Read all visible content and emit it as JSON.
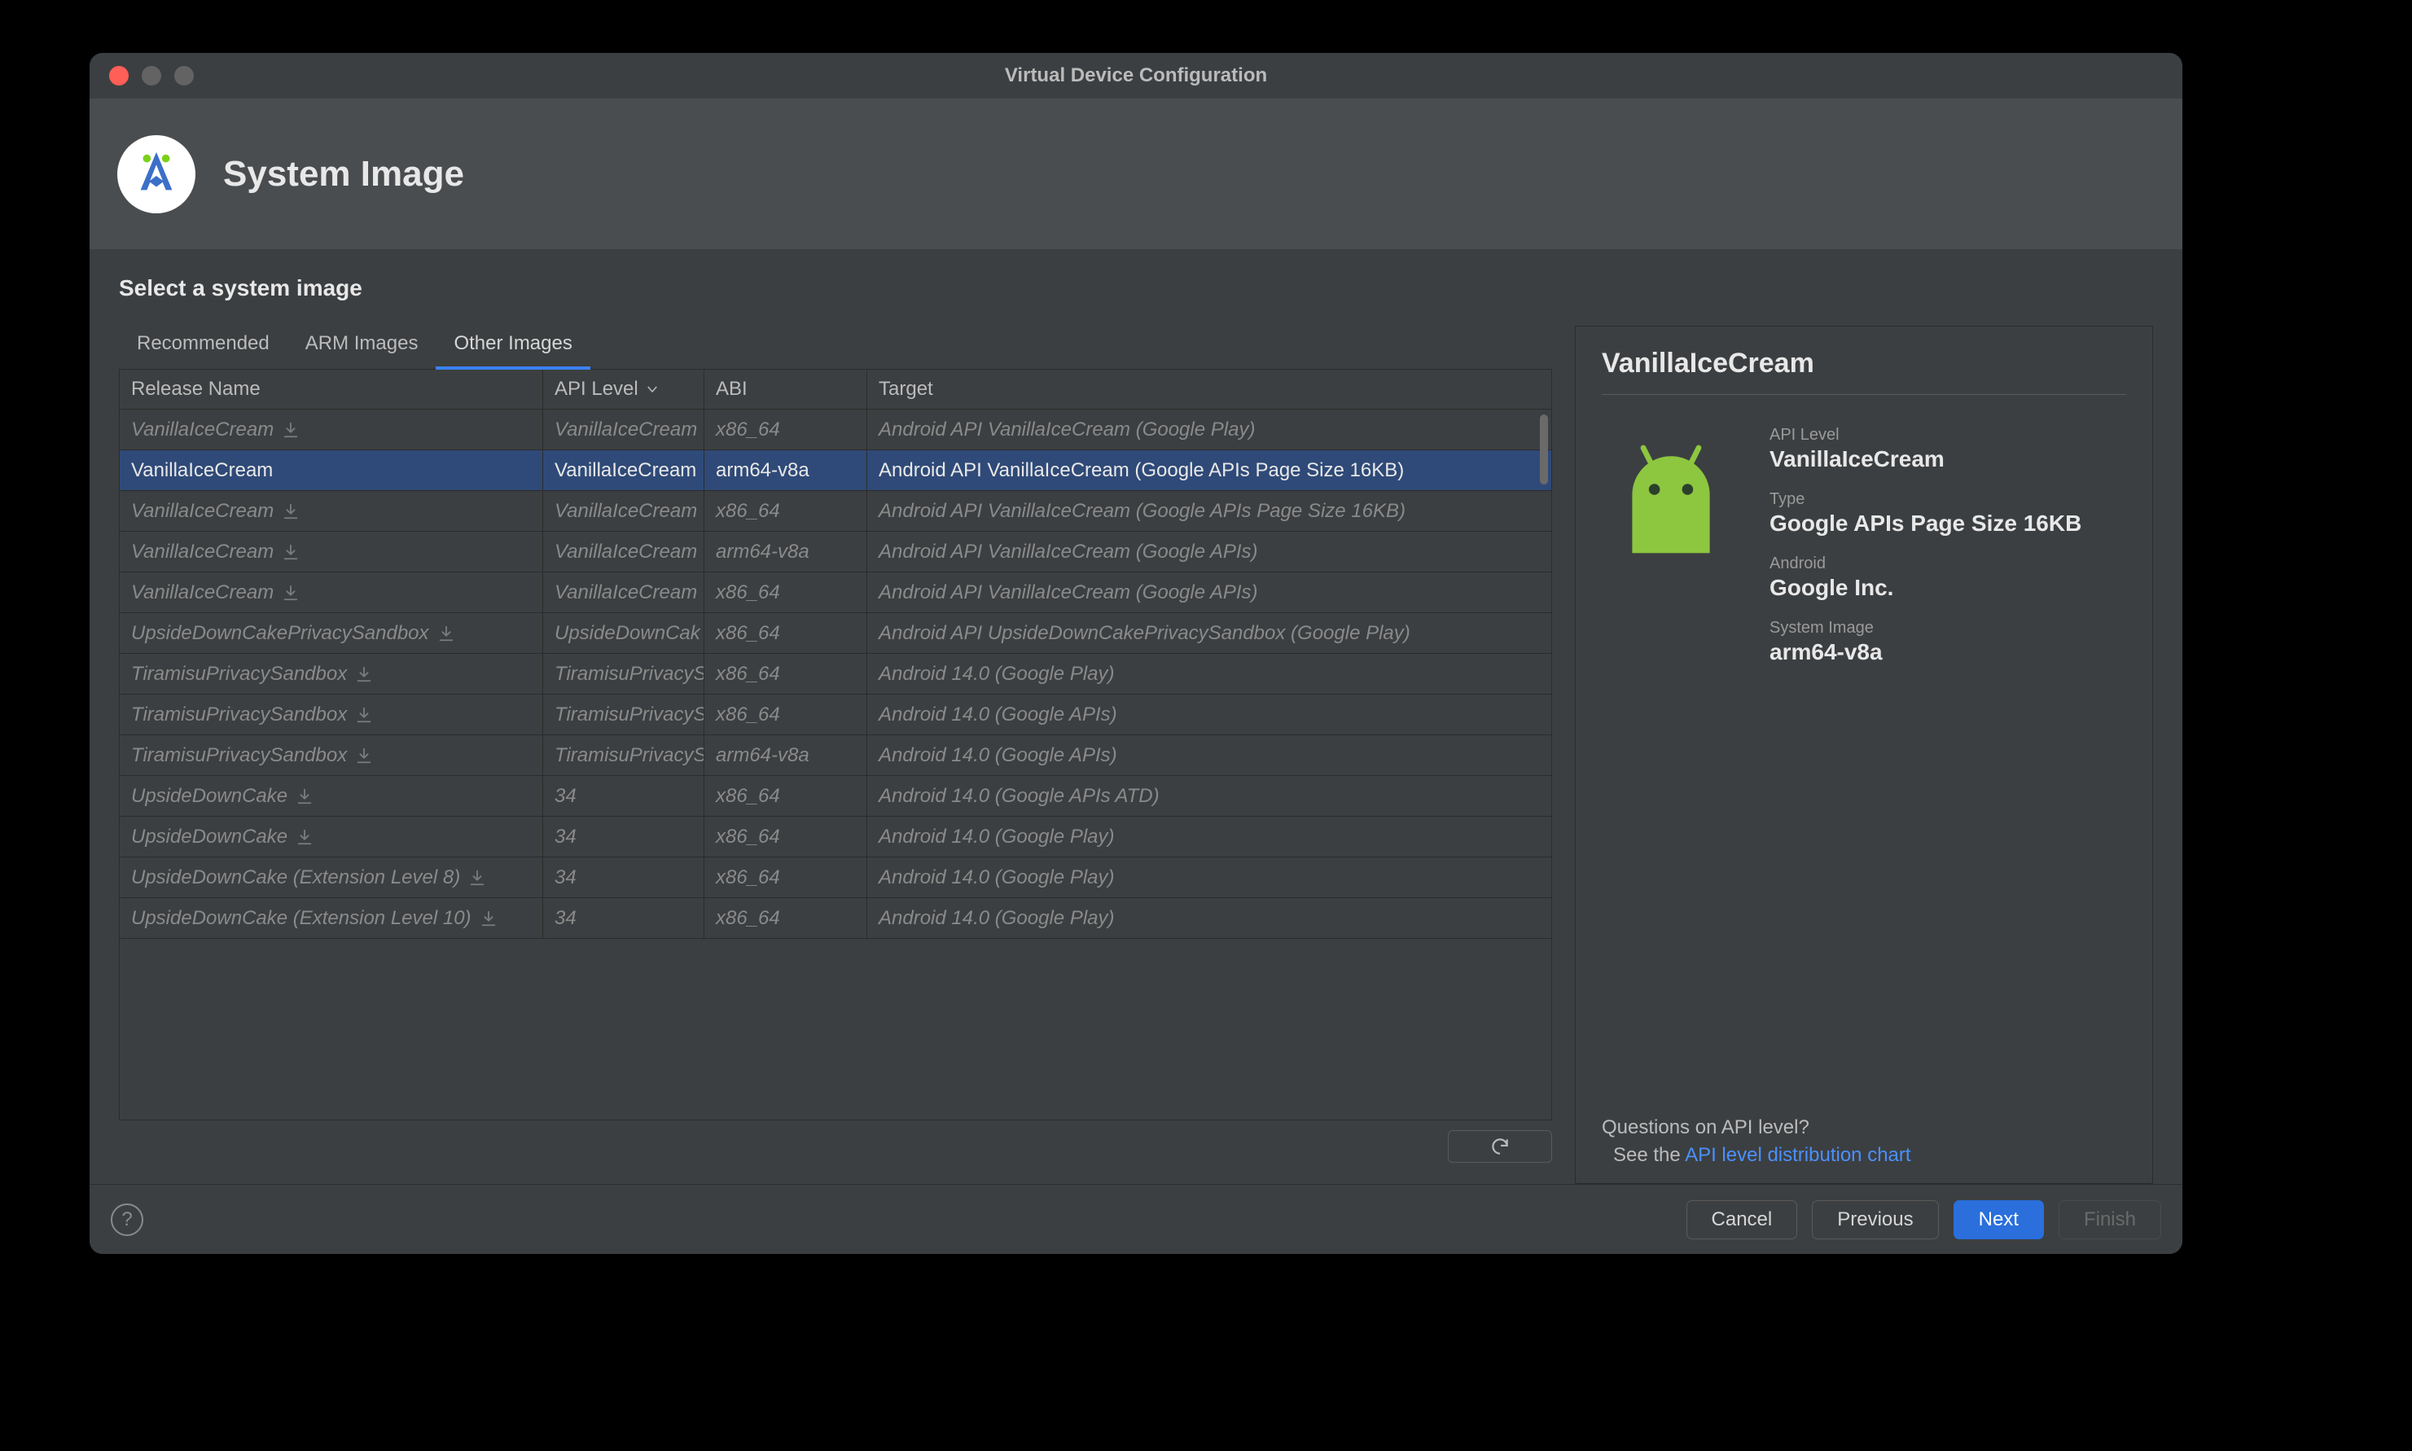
{
  "window": {
    "title": "Virtual Device Configuration"
  },
  "header": {
    "title": "System Image"
  },
  "section": {
    "title": "Select a system image"
  },
  "tabs": [
    {
      "label": "Recommended",
      "active": false
    },
    {
      "label": "ARM Images",
      "active": false
    },
    {
      "label": "Other Images",
      "active": true
    }
  ],
  "table": {
    "columns": [
      "Release Name",
      "API Level",
      "ABI",
      "Target"
    ],
    "sort_column": "API Level",
    "sort_dir": "desc",
    "rows": [
      {
        "release": "VanillaIceCream",
        "download": true,
        "api": "VanillaIceCream",
        "abi": "x86_64",
        "target": "Android API VanillaIceCream (Google Play)",
        "selected": false
      },
      {
        "release": "VanillaIceCream",
        "download": false,
        "api": "VanillaIceCream",
        "abi": "arm64-v8a",
        "target": "Android API VanillaIceCream (Google APIs Page Size 16KB)",
        "selected": true
      },
      {
        "release": "VanillaIceCream",
        "download": true,
        "api": "VanillaIceCream",
        "abi": "x86_64",
        "target": "Android API VanillaIceCream (Google APIs Page Size 16KB)",
        "selected": false
      },
      {
        "release": "VanillaIceCream",
        "download": true,
        "api": "VanillaIceCream",
        "abi": "arm64-v8a",
        "target": "Android API VanillaIceCream (Google APIs)",
        "selected": false
      },
      {
        "release": "VanillaIceCream",
        "download": true,
        "api": "VanillaIceCream",
        "abi": "x86_64",
        "target": "Android API VanillaIceCream (Google APIs)",
        "selected": false
      },
      {
        "release": "UpsideDownCakePrivacySandbox",
        "download": true,
        "api": "UpsideDownCak",
        "abi": "x86_64",
        "target": "Android API UpsideDownCakePrivacySandbox (Google Play)",
        "selected": false
      },
      {
        "release": "TiramisuPrivacySandbox",
        "download": true,
        "api": "TiramisuPrivacyS",
        "abi": "x86_64",
        "target": "Android 14.0 (Google Play)",
        "selected": false
      },
      {
        "release": "TiramisuPrivacySandbox",
        "download": true,
        "api": "TiramisuPrivacyS",
        "abi": "x86_64",
        "target": "Android 14.0 (Google APIs)",
        "selected": false
      },
      {
        "release": "TiramisuPrivacySandbox",
        "download": true,
        "api": "TiramisuPrivacyS",
        "abi": "arm64-v8a",
        "target": "Android 14.0 (Google APIs)",
        "selected": false
      },
      {
        "release": "UpsideDownCake",
        "download": true,
        "api": "34",
        "abi": "x86_64",
        "target": "Android 14.0 (Google APIs ATD)",
        "selected": false
      },
      {
        "release": "UpsideDownCake",
        "download": true,
        "api": "34",
        "abi": "x86_64",
        "target": "Android 14.0 (Google Play)",
        "selected": false
      },
      {
        "release": "UpsideDownCake (Extension Level 8)",
        "download": true,
        "api": "34",
        "abi": "x86_64",
        "target": "Android 14.0 (Google Play)",
        "selected": false
      },
      {
        "release": "UpsideDownCake (Extension Level 10)",
        "download": true,
        "api": "34",
        "abi": "x86_64",
        "target": "Android 14.0 (Google Play)",
        "selected": false
      }
    ]
  },
  "detail": {
    "title": "VanillaIceCream",
    "fields": [
      {
        "label": "API Level",
        "value": "VanillaIceCream"
      },
      {
        "label": "Type",
        "value": "Google APIs Page Size 16KB"
      },
      {
        "label": "Android",
        "value": "Google Inc."
      },
      {
        "label": "System Image",
        "value": "arm64-v8a"
      }
    ],
    "questions": {
      "line1": "Questions on API level?",
      "prefix": "See the ",
      "link": "API level distribution chart"
    }
  },
  "footer": {
    "cancel": "Cancel",
    "previous": "Previous",
    "next": "Next",
    "finish": "Finish"
  },
  "colors": {
    "accent": "#2a6fdb",
    "link": "#4a90ff",
    "android": "#8dc63f",
    "selected_row": "#2f4a78",
    "bg": "#3c3f41"
  }
}
